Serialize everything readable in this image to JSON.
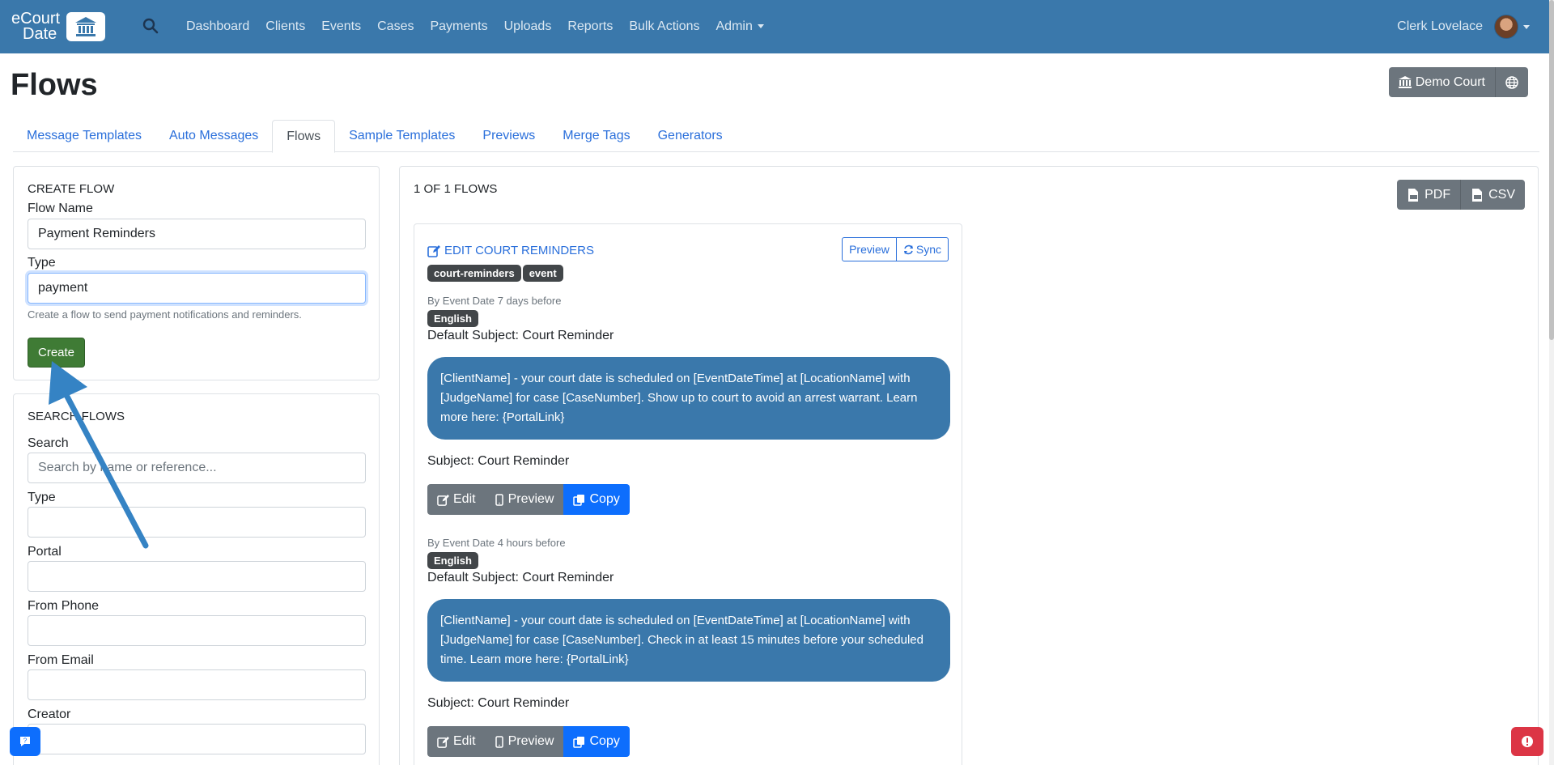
{
  "nav": {
    "brand_line1": "eCourt",
    "brand_line2": "Date",
    "links": [
      "Dashboard",
      "Clients",
      "Events",
      "Cases",
      "Payments",
      "Uploads",
      "Reports",
      "Bulk Actions",
      "Admin"
    ],
    "user_name": "Clerk Lovelace",
    "bg_color": "#3a78ab"
  },
  "page": {
    "title": "Flows",
    "court_button": "Demo Court"
  },
  "tabs": [
    "Message Templates",
    "Auto Messages",
    "Flows",
    "Sample Templates",
    "Previews",
    "Merge Tags",
    "Generators"
  ],
  "active_tab": "Flows",
  "create_flow": {
    "heading": "CREATE FLOW",
    "name_label": "Flow Name",
    "name_value": "Payment Reminders",
    "type_label": "Type",
    "type_value": "payment",
    "help": "Create a flow to send payment notifications and reminders.",
    "button": "Create"
  },
  "search_flows": {
    "heading": "SEARCH FLOWS",
    "search_label": "Search",
    "search_placeholder": "Search by name or reference...",
    "type_label": "Type",
    "portal_label": "Portal",
    "from_phone_label": "From Phone",
    "from_email_label": "From Email",
    "creator_label": "Creator"
  },
  "flows": {
    "count_label": "1 OF 1 FLOWS",
    "pdf": "PDF",
    "csv": "CSV",
    "item": {
      "title": "EDIT COURT REMINDERS",
      "preview": "Preview",
      "sync": "Sync",
      "tags": [
        "court-reminders",
        "event"
      ],
      "messages": [
        {
          "timing": "By Event Date 7 days before",
          "language": "English",
          "default_subject": "Default Subject: Court Reminder",
          "body": "[ClientName] - your court date is scheduled on [EventDateTime] at [LocationName] with [JudgeName] for case [CaseNumber]. Show up to court to avoid an arrest warrant. Learn more here: {PortalLink}",
          "subject": "Subject: Court Reminder"
        },
        {
          "timing": "By Event Date 4 hours before",
          "language": "English",
          "default_subject": "Default Subject: Court Reminder",
          "body": "[ClientName] - your court date is scheduled on [EventDateTime] at [LocationName] with [JudgeName] for case [CaseNumber]. Check in at least 15 minutes before your scheduled time. Learn more here: {PortalLink}",
          "subject": "Subject: Court Reminder"
        }
      ],
      "edit": "Edit",
      "preview_btn": "Preview",
      "copy": "Copy"
    }
  }
}
